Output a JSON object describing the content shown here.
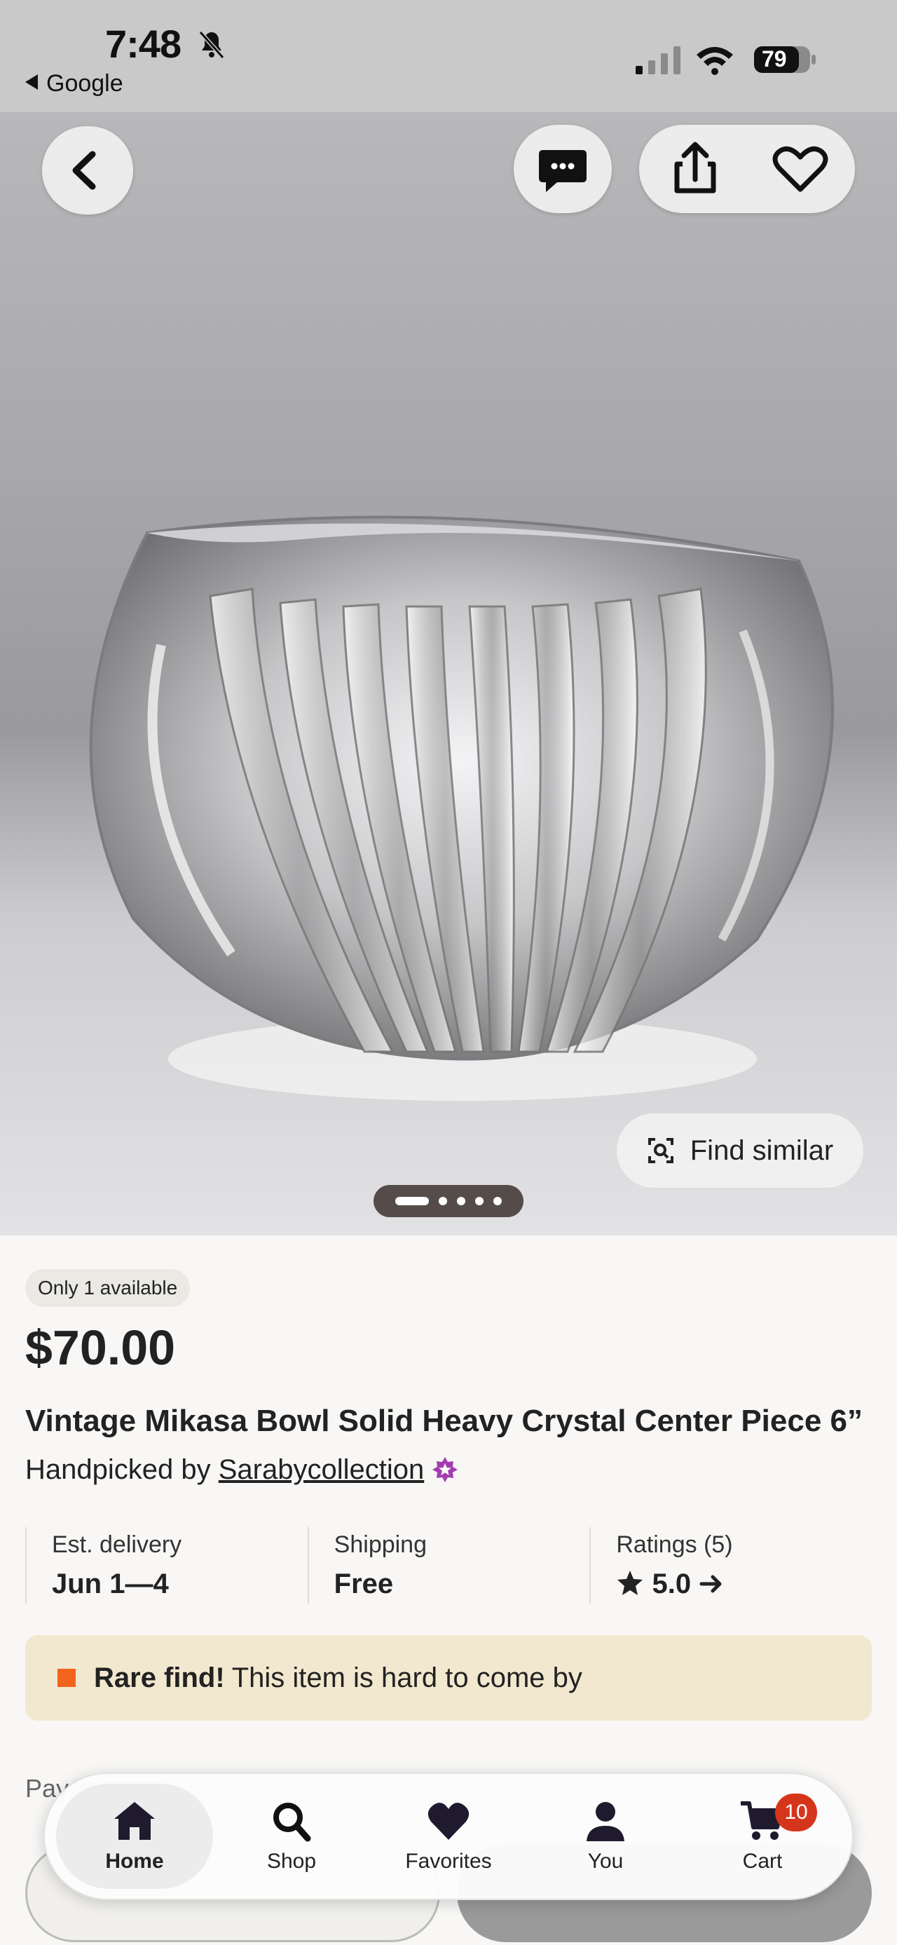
{
  "status_bar": {
    "time": "7:48",
    "back_app": "Google",
    "battery": "79"
  },
  "hero": {
    "find_similar": "Find similar",
    "image_count": 5,
    "active_image": 1
  },
  "listing": {
    "availability_badge": "Only 1 available",
    "price": "$70.00",
    "title": "Vintage Mikasa Bowl Solid Heavy Crystal Center Piece 6”",
    "seller_prefix": "Handpicked by",
    "seller_name": "Sarabycollection",
    "info": [
      {
        "label": "Est. delivery",
        "value": "Jun 1—4"
      },
      {
        "label": "Shipping",
        "value": "Free"
      },
      {
        "label": "Ratings (5)",
        "value": "5.0"
      }
    ],
    "rare_find_bold": "Rare find!",
    "rare_find_text": "This item is hard to come by",
    "pay_prefix": "Pay"
  },
  "tabbar": {
    "tabs": [
      {
        "label": "Home",
        "icon": "home-icon"
      },
      {
        "label": "Shop",
        "icon": "search-icon"
      },
      {
        "label": "Favorites",
        "icon": "heart-icon"
      },
      {
        "label": "You",
        "icon": "person-icon"
      },
      {
        "label": "Cart",
        "icon": "cart-icon"
      }
    ],
    "cart_count": "10"
  },
  "colors": {
    "accent_orange": "#f1641e",
    "rare_bg": "#f2e8cf",
    "badge_red": "#d5361b",
    "star_badge_purple": "#a23db0"
  }
}
